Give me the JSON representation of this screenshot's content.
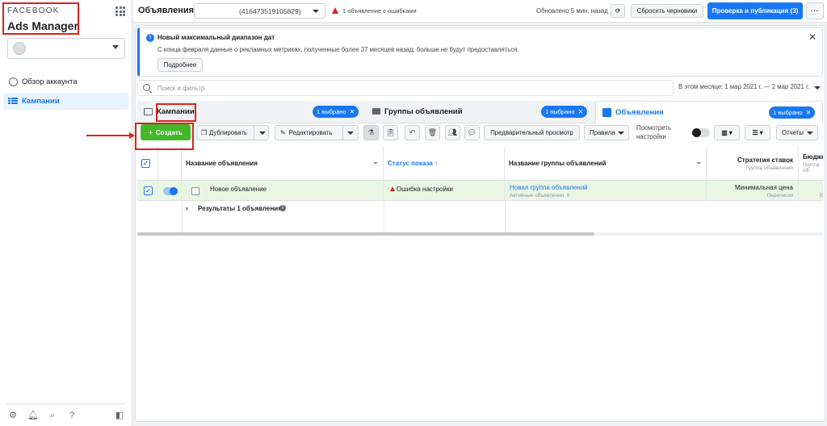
{
  "brand": {
    "company": "FACEBOOK",
    "app": "Ads Manager"
  },
  "sidebar": {
    "items": [
      {
        "label": "Обзор аккаунта",
        "icon": "gauge-icon",
        "active": false
      },
      {
        "label": "Кампании",
        "icon": "campaigns-table-icon",
        "active": true
      }
    ],
    "footer_icons": [
      "gear-icon",
      "bell-icon",
      "search-icon",
      "help-icon",
      "sidebar-collapse-icon"
    ]
  },
  "topbar": {
    "title": "Объявления",
    "account_id": "(416473519105829)",
    "error_text": "1 объявление с ошибками",
    "updated_text": "Обновлено 5 мин. назад",
    "reset_label": "Сбросить черновики",
    "publish_label": "Проверка и публикация (3)",
    "more_label": "···"
  },
  "banner": {
    "title": "Новый максимальный диапазон дат",
    "text": "С конца февраля данные о рекламных метриках, полученные более 37 месяцев назад, больше не будут предоставляться.",
    "button_label": "Подробнее",
    "close_label": "✕"
  },
  "search": {
    "placeholder": "Поиск и фильтр",
    "date_range": "В этом месяце: 1 мар 2021 г. — 2 мар 2021 г."
  },
  "tabs": [
    {
      "label": "Кампании",
      "chip": "1 выбрано",
      "icon": "folder-icon",
      "active": false
    },
    {
      "label": "Группы объявлений",
      "chip": "1 выбрано",
      "icon": "ad-groups-icon",
      "active": false
    },
    {
      "label": "Объявления",
      "chip": "1 выбрано",
      "icon": "ad-icon",
      "active": true
    }
  ],
  "toolbar": {
    "create_label": "Создать",
    "duplicate_label": "Дублировать",
    "edit_label": "Редактировать",
    "preview_label": "Предварительный просмотр",
    "rules_label": "Правила",
    "view_settings_label": "Посмотреть настройки",
    "reports_label": "Отчеты"
  },
  "table": {
    "headers": {
      "name": "Название объявления",
      "status": "Статус показа ↑",
      "group": "Название группы объявлений",
      "bid": "Стратегия ставок",
      "bid_sub": "Группа объявлений",
      "budget": "Бюджет",
      "budget_sub": "Группа об"
    },
    "rows": [
      {
        "name": "Новое объявление",
        "status": "Ошибка настройки",
        "group": "Новая группа объявлений",
        "group_sub": "Активные объявления: 0",
        "bid": "Минимальная цена",
        "bid_sub": "Переписки",
        "budget_sub": "Е"
      }
    ],
    "results_label": "Результаты 1 объявления",
    "results_info": "i"
  },
  "colors": {
    "accent": "#1877f2",
    "create_green": "#42b72a",
    "error_red": "#e0211b",
    "annotation_red": "#e0211b",
    "selected_row": "#e9f6e4"
  }
}
